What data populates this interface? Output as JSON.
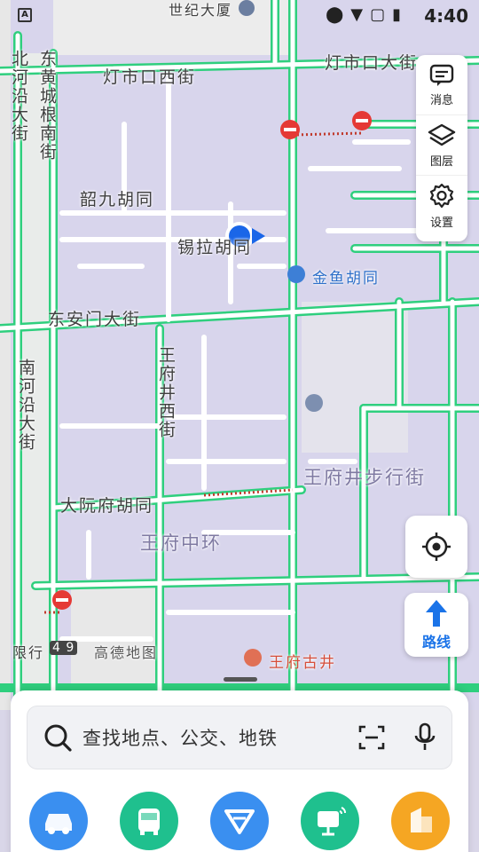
{
  "status_bar": {
    "time": "4:40",
    "left_icon": "A"
  },
  "map": {
    "roads_labels": {
      "dengshikou_west": "灯市口西街",
      "dengshikou_east": "灯市口大街",
      "dong_an_men": "东安门大街",
      "shaojiu": "韶九胡同",
      "xila": "锡拉胡同",
      "dayuanfu": "大阮府胡同",
      "beiheyan": "北河沿大街",
      "donghuangcheng": "东黄城根南街",
      "nanheyan": "南河沿大街",
      "wangfujing_west": "王府井西街",
      "wangfujing_walk": "王府井步行街",
      "wangfu_central": "王府中环",
      "top_building": "世纪大厦"
    },
    "pois": {
      "jinyu": "金鱼胡同",
      "wangfu_gujing": "王府古井",
      "gaode": "高德地图",
      "xianxing": "限行",
      "xianxing_nums": "4 9"
    }
  },
  "right_panel": {
    "messages": "消息",
    "layers": "图层",
    "settings": "设置"
  },
  "route_button": "路线",
  "search": {
    "placeholder": "查找地点、公交、地铁"
  },
  "quick_actions": [
    {
      "name": "驾车",
      "color": "#3a8ff0"
    },
    {
      "name": "公交",
      "color": "#1fc08e"
    },
    {
      "name": "导航",
      "color": "#3a8ff0"
    },
    {
      "name": "地铁",
      "color": "#1fc08e"
    },
    {
      "name": "周边",
      "color": "#f5a623"
    }
  ]
}
